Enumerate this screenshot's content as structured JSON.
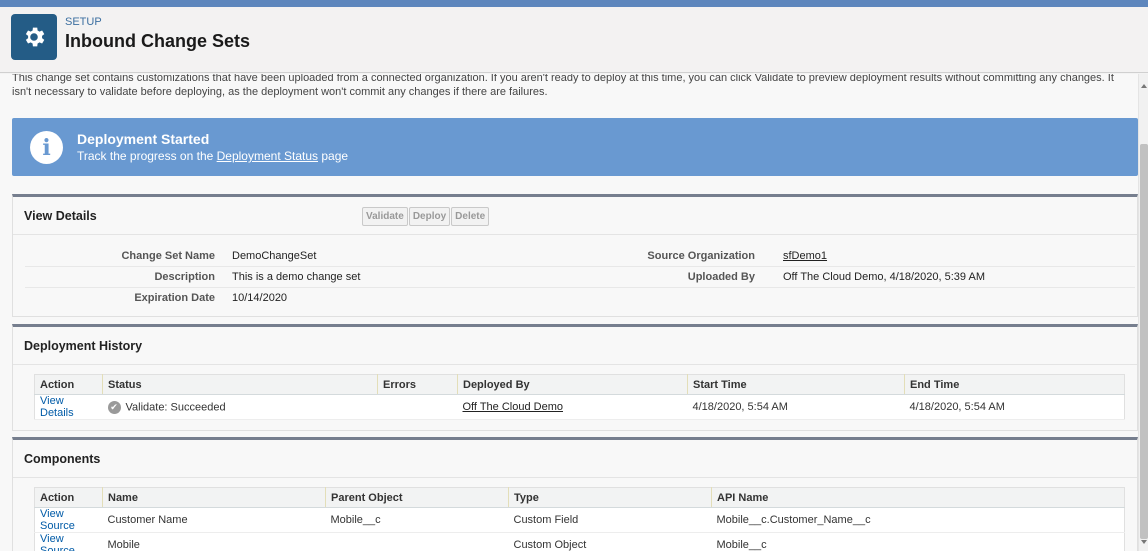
{
  "header": {
    "kicker": "SETUP",
    "title": "Inbound Change Sets"
  },
  "intro": {
    "text": "This change set contains customizations that have been uploaded from a connected organization. If you aren't ready to deploy at this time, you can click Validate to preview deployment results without committing any changes. It isn't necessary to validate before deploying, as the deployment won't commit any changes if there are failures."
  },
  "banner": {
    "title": "Deployment Started",
    "text_before": "Track the progress on the ",
    "link": "Deployment Status",
    "text_after": " page",
    "color": "#6999d1"
  },
  "view_details": {
    "title": "View Details",
    "buttons": {
      "validate": "Validate",
      "deploy": "Deploy",
      "delete": "Delete"
    },
    "fields": {
      "change_set_name": {
        "label": "Change Set Name",
        "value": "DemoChangeSet"
      },
      "description": {
        "label": "Description",
        "value": "This is a demo change set"
      },
      "expiration_date": {
        "label": "Expiration Date",
        "value": "10/14/2020"
      },
      "source_org": {
        "label": "Source Organization",
        "value": "sfDemo1"
      },
      "uploaded_by": {
        "label": "Uploaded By",
        "value": "Off The Cloud Demo, 4/18/2020, 5:39 AM"
      }
    }
  },
  "deployment_history": {
    "title": "Deployment History",
    "columns": {
      "action": "Action",
      "status": "Status",
      "errors": "Errors",
      "deployed_by": "Deployed By",
      "start_time": "Start Time",
      "end_time": "End Time"
    },
    "rows": [
      {
        "action": "View Details",
        "status": "Validate: Succeeded",
        "errors": "",
        "deployed_by": "Off The Cloud Demo",
        "start_time": "4/18/2020, 5:54 AM",
        "end_time": "4/18/2020, 5:54 AM"
      }
    ]
  },
  "components": {
    "title": "Components",
    "columns": {
      "action": "Action",
      "name": "Name",
      "parent_object": "Parent Object",
      "type": "Type",
      "api_name": "API Name"
    },
    "rows": [
      {
        "action": "View Source",
        "name": "Customer Name",
        "parent_object": "Mobile__c",
        "type": "Custom Field",
        "api_name": "Mobile__c.Customer_Name__c"
      },
      {
        "action": "View Source",
        "name": "Mobile",
        "parent_object": "",
        "type": "Custom Object",
        "api_name": "Mobile__c"
      }
    ]
  },
  "icons": {
    "header": "gear-icon",
    "banner": "info-icon",
    "status": "check-circle-icon"
  },
  "colors": {
    "header_icon_bg": "#245c86",
    "section_border": "#767e8e",
    "link": "#015ba7"
  }
}
